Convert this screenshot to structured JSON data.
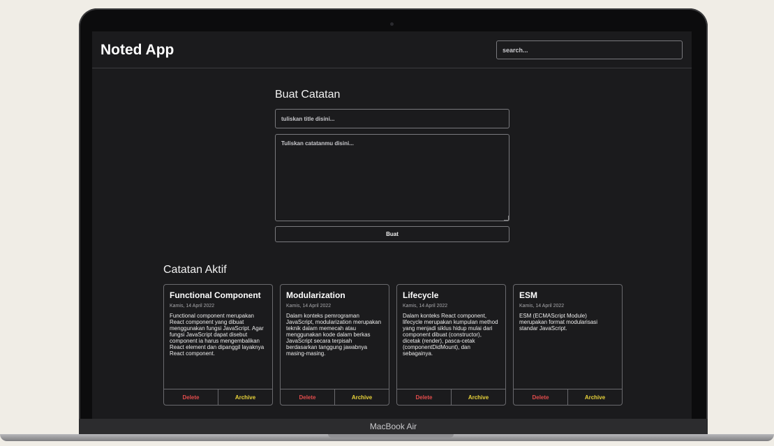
{
  "app": {
    "title": "Noted App",
    "search_placeholder": "search..."
  },
  "form": {
    "heading": "Buat Catatan",
    "title_placeholder": "tuliskan title disini...",
    "body_placeholder": "Tuliskan catatanmu disini...",
    "submit_label": "Buat"
  },
  "active_section": {
    "heading": "Catatan Aktif"
  },
  "notes": [
    {
      "title": "Functional Component",
      "date": "Kamis, 14 April 2022",
      "body": "Functional component merupakan React component yang dibuat menggunakan fungsi JavaScript. Agar fungsi JavaScript dapat disebut component ia harus mengembalikan React element dan dipanggil layaknya React component.",
      "delete_label": "Delete",
      "archive_label": "Archive"
    },
    {
      "title": "Modularization",
      "date": "Kamis, 14 April 2022",
      "body": "Dalam konteks pemrograman JavaScript, modularization merupakan teknik dalam memecah atau menggunakan kode dalam berkas JavaScript secara terpisah berdasarkan tanggung jawabnya masing-masing.",
      "delete_label": "Delete",
      "archive_label": "Archive"
    },
    {
      "title": "Lifecycle",
      "date": "Kamis, 14 April 2022",
      "body": "Dalam konteks React component, lifecycle merupakan kumpulan method yang menjadi siklus hidup mulai dari component dibuat (constructor), dicetak (render), pasca-cetak (componentDidMount), dan sebagainya.",
      "delete_label": "Delete",
      "archive_label": "Archive"
    },
    {
      "title": "ESM",
      "date": "Kamis, 14 April 2022",
      "body": "ESM (ECMAScript Module) merupakan format modularisasi standar JavaScript.",
      "delete_label": "Delete",
      "archive_label": "Archive"
    }
  ],
  "device": {
    "label": "MacBook Air"
  },
  "colors": {
    "background": "#f0ede6",
    "app_background": "#1b1b1d",
    "delete": "#e24c4c",
    "archive": "#e8d23a"
  }
}
